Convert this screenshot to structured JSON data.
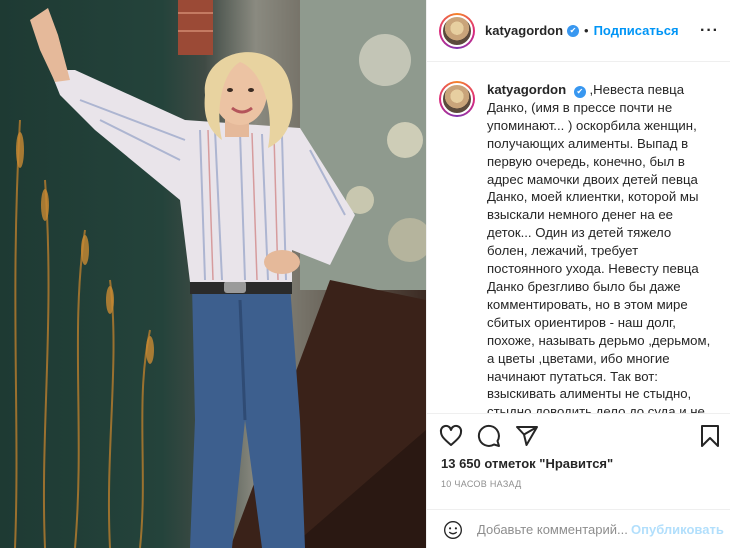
{
  "post": {
    "username": "katyagordon",
    "verified_icon": "verified-badge-icon",
    "follow_separator": "•",
    "follow_label": "Подписаться",
    "more_label": "···",
    "caption": "Невеста певца Данко, (имя в прессе почти не упоминают... ) оскорбила женщин, получающих алименты. Выпад в первую очередь, конечно, был в адрес мамочки двоих детей певца Данко, моей клиентки, которой мы взыскали немного денег на ее деток... Один из детей тяжело болен, лежачий, требует постоянного ухода. Невесту певца Данко брезгливо было бы даже комментировать, но в этом мире сбитых ориентиров - наш долг, похоже, называть дерьмо ,дерьмом, а цветы ,цветами, ибо многие начинают путаться. Так вот: взыскивать алименты не стыдно, стыдно доводить дело до суда и не помогать, ухода детям, своим детям",
    "likes": "13 650 отметок \"Нравится\"",
    "time": "10 ЧАСОВ НАЗАД",
    "comment_placeholder": "Добавьте комментарий...",
    "publish_label": "Опубликовать",
    "icons": [
      "heart-icon",
      "comment-icon",
      "share-icon",
      "bookmark-icon",
      "emoji-icon"
    ],
    "colors": {
      "link": "#0095f6",
      "publish_disabled": "#b2dffc",
      "muted": "#8e8e8e",
      "verified": "#3897f0"
    }
  }
}
